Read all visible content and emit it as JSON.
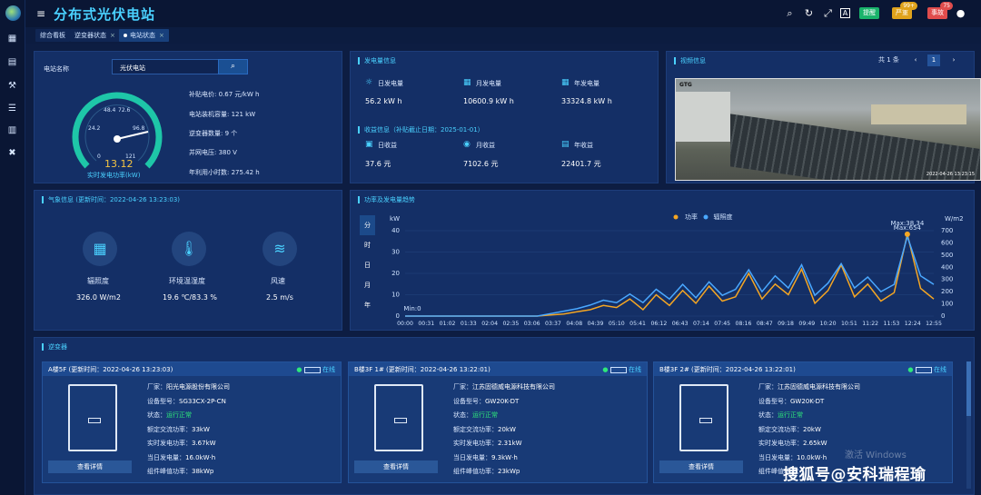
{
  "app": {
    "title": "分布式光伏电站"
  },
  "header": {
    "badges": [
      {
        "label": "提醒",
        "color": "#19b36b",
        "count": ""
      },
      {
        "label": "严重",
        "color": "#e0a31c",
        "count": "99+"
      },
      {
        "label": "事故",
        "color": "#e04c4c",
        "count": "75"
      }
    ]
  },
  "tabs": [
    {
      "label": "综合看板",
      "closable": false,
      "active": false
    },
    {
      "label": "逆变器状态",
      "closable": true,
      "active": false
    },
    {
      "label": "电站状态",
      "closable": true,
      "active": true
    }
  ],
  "station": {
    "name_label": "电站名称",
    "name_value": "光伏电站",
    "gauge": {
      "value": "13.12",
      "label": "实时发电功率(kW)",
      "ticks": [
        "0",
        "24.2",
        "48.4",
        "72.6",
        "96.8",
        "121"
      ],
      "max": 121,
      "current": 13.12
    },
    "info": [
      {
        "label": "补贴电价:",
        "value": "0.67 元/kW h"
      },
      {
        "label": "电站装机容量:",
        "value": "121 kW"
      },
      {
        "label": "逆变器数量:",
        "value": "9 个"
      },
      {
        "label": "并网电压:",
        "value": "380 V"
      },
      {
        "label": "年利用小时数:",
        "value": "275.42 h"
      }
    ]
  },
  "generation": {
    "title": "发电量信息",
    "items": [
      {
        "label": "日发电量",
        "value": "56.2 kW h",
        "icon": "sun-icon"
      },
      {
        "label": "月发电量",
        "value": "10600.9 kW h",
        "icon": "calendar-icon"
      },
      {
        "label": "年发电量",
        "value": "33324.8 kW h",
        "icon": "calendar-icon"
      }
    ],
    "income_title": "收益信息（补贴截止日期：2025-01-01）",
    "income": [
      {
        "label": "日收益",
        "value": "37.6 元",
        "icon": "money-icon"
      },
      {
        "label": "月收益",
        "value": "7102.6 元",
        "icon": "money-bag-icon"
      },
      {
        "label": "年收益",
        "value": "22401.7 元",
        "icon": "money-calendar-icon"
      }
    ]
  },
  "video": {
    "title": "视频信息",
    "pager_text": "共 1 条",
    "page": "1",
    "cam_logo": "GTG",
    "cam_time": "2022-04-26 13:23:15"
  },
  "weather": {
    "title": "气象信息 (更新时间：2022-04-26 13:23:03)",
    "items": [
      {
        "label": "辐照度",
        "value": "326.0 W/m2",
        "icon": "solar-panel-icon"
      },
      {
        "label": "环境温湿度",
        "value": "19.6 ℃/83.3 %",
        "icon": "thermometer-icon"
      },
      {
        "label": "风速",
        "value": "2.5 m/s",
        "icon": "wind-icon"
      }
    ]
  },
  "trend": {
    "title": "功率及发电量趋势",
    "tabs": [
      "分",
      "时",
      "日",
      "月",
      "年"
    ],
    "active_tab": "分"
  },
  "chart_data": {
    "type": "line",
    "title": "",
    "legend_position": "top-center",
    "ylabel_left": "kW",
    "ylabel_right": "W/m2",
    "ylim_left": [
      0,
      40
    ],
    "ylim_right": [
      0,
      700
    ],
    "yticks_left": [
      "0",
      "10",
      "20",
      "30",
      "40"
    ],
    "yticks_right": [
      "0",
      "100",
      "200",
      "300",
      "400",
      "500",
      "600",
      "700"
    ],
    "x_ticks": [
      "00:00",
      "00:31",
      "01:02",
      "01:33",
      "02:04",
      "02:35",
      "03:06",
      "03:37",
      "04:08",
      "04:39",
      "05:10",
      "05:41",
      "06:12",
      "06:43",
      "07:14",
      "07:45",
      "08:16",
      "08:47",
      "09:18",
      "09:49",
      "10:20",
      "10:51",
      "11:22",
      "11:53",
      "12:24",
      "12:55"
    ],
    "annotations": {
      "max": "Max:38.34",
      "max2": "Max:654",
      "min": "Min:0"
    },
    "series": [
      {
        "name": "功率",
        "color": "#f5a623",
        "axis": "left",
        "values": [
          0,
          0,
          0,
          0,
          0,
          0,
          0,
          0,
          0,
          0,
          0,
          0.5,
          1,
          2,
          3,
          5,
          4,
          8,
          3,
          10,
          5,
          12,
          6,
          14,
          7,
          9,
          20,
          8,
          15,
          10,
          22,
          6,
          12,
          24,
          9,
          15,
          7,
          11,
          38.34,
          13,
          8
        ]
      },
      {
        "name": "辐照度",
        "color": "#4aa8ff",
        "axis": "right",
        "values": [
          0,
          0,
          0,
          0,
          0,
          0,
          0,
          0,
          0,
          0,
          0,
          20,
          40,
          60,
          90,
          130,
          110,
          180,
          110,
          220,
          140,
          260,
          150,
          280,
          170,
          220,
          380,
          200,
          330,
          230,
          420,
          170,
          270,
          430,
          230,
          320,
          200,
          260,
          654,
          330,
          260
        ]
      }
    ]
  },
  "inverters": {
    "title": "逆变器",
    "items": [
      {
        "name": "A楼5F (更新时间：2022-04-26 13:23:03)",
        "status_text": "在线",
        "fields": [
          {
            "label": "厂家：",
            "value": "阳光电源股份有限公司"
          },
          {
            "label": "设备型号：",
            "value": "SG33CX-2P-CN"
          },
          {
            "label": "状态：",
            "value": "运行正常",
            "ok": true
          },
          {
            "label": "额定交流功率：",
            "value": "33kW"
          },
          {
            "label": "实时发电功率：",
            "value": "3.67kW"
          },
          {
            "label": "当日发电量：",
            "value": "16.0kW·h"
          },
          {
            "label": "组件峰值功率：",
            "value": "38kWp"
          }
        ],
        "detail_label": "查看详情"
      },
      {
        "name": "B楼3F 1# (更新时间：2022-04-26 13:22:01)",
        "status_text": "在线",
        "fields": [
          {
            "label": "厂家：",
            "value": "江苏固德威电源科技有限公司"
          },
          {
            "label": "设备型号：",
            "value": "GW20K-DT"
          },
          {
            "label": "状态：",
            "value": "运行正常",
            "ok": true
          },
          {
            "label": "额定交流功率：",
            "value": "20kW"
          },
          {
            "label": "实时发电功率：",
            "value": "2.31kW"
          },
          {
            "label": "当日发电量：",
            "value": "9.3kW·h"
          },
          {
            "label": "组件峰值功率：",
            "value": "23kWp"
          }
        ],
        "detail_label": "查看详情"
      },
      {
        "name": "B楼3F 2# (更新时间：2022-04-26 13:22:01)",
        "status_text": "在线",
        "fields": [
          {
            "label": "厂家：",
            "value": "江苏固德威电源科技有限公司"
          },
          {
            "label": "设备型号：",
            "value": "GW20K-DT"
          },
          {
            "label": "状态：",
            "value": "运行正常",
            "ok": true
          },
          {
            "label": "额定交流功率：",
            "value": "20kW"
          },
          {
            "label": "实时发电功率：",
            "value": "2.65kW"
          },
          {
            "label": "当日发电量：",
            "value": "10.0kW·h"
          },
          {
            "label": "组件峰值功率：",
            "value": ""
          }
        ],
        "detail_label": "查看详情"
      }
    ]
  },
  "overlay": {
    "watermark": "搜狐号@安科瑞程瑜",
    "windows": "激活 Windows"
  }
}
